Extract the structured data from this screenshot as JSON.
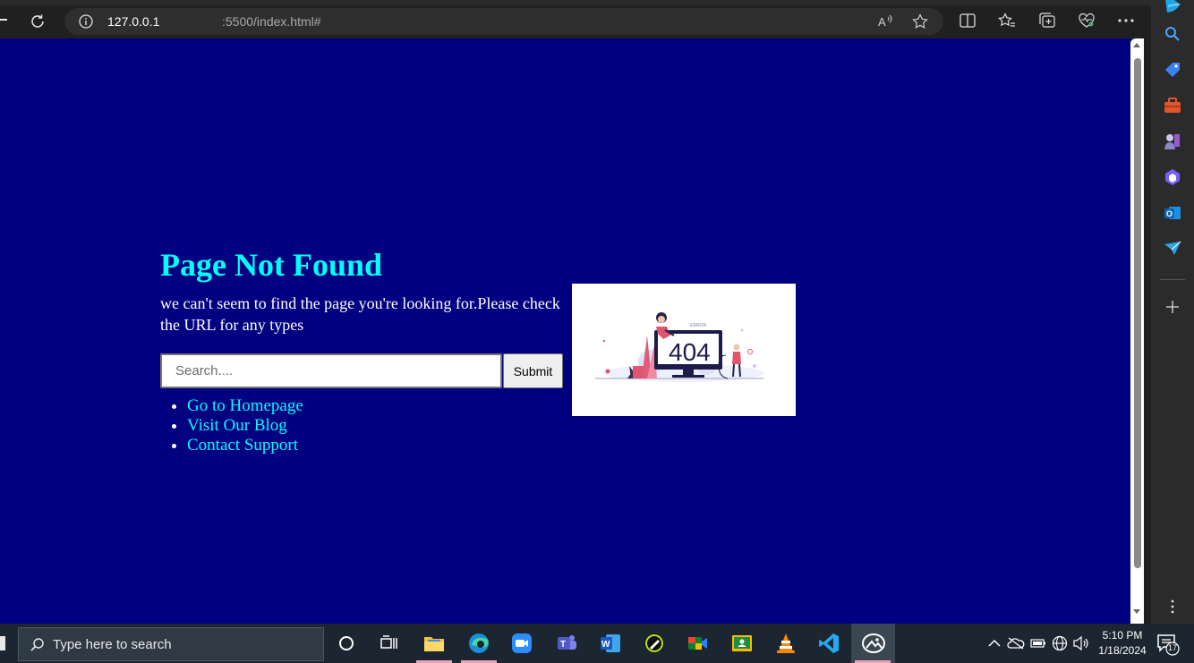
{
  "browser": {
    "url_host": "127.0.0.1",
    "url_rest": ":5500/index.html#"
  },
  "page": {
    "title": "Page Not Found",
    "message": "we can't seem to find the page you're looking for.Please check the URL for any types",
    "search_placeholder": "Search....",
    "submit_label": "Submit",
    "links": [
      "Go to Homepage",
      "Visit Our Blog",
      "Contact Support"
    ],
    "illustration_caption": "ERROR",
    "illustration_code": "404"
  },
  "taskbar": {
    "search_placeholder": "Type here to search",
    "time": "5:10 PM",
    "date": "1/18/2024",
    "notification_count": "17"
  },
  "colors": {
    "page_bg": "#000080",
    "title": "#00ffff",
    "links": "#00ffff"
  }
}
